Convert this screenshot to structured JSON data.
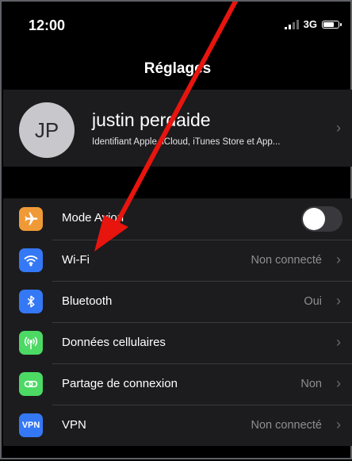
{
  "status_bar": {
    "time": "12:00",
    "network": "3G"
  },
  "nav": {
    "title": "Réglages"
  },
  "profile": {
    "initials": "JP",
    "name": "justin perdaide",
    "subtitle": "Identifiant Apple, iCloud, iTunes Store et App..."
  },
  "settings": [
    {
      "label": "Mode Avion",
      "value": "",
      "icon": "airplane-icon",
      "color": "#f09a37"
    },
    {
      "label": "Wi-Fi",
      "value": "Non connecté",
      "icon": "wifi-icon",
      "color": "#3478f6"
    },
    {
      "label": "Bluetooth",
      "value": "Oui",
      "icon": "bluetooth-icon",
      "color": "#3478f6"
    },
    {
      "label": "Données cellulaires",
      "value": "",
      "icon": "antenna-icon",
      "color": "#4cd964"
    },
    {
      "label": "Partage de connexion",
      "value": "Non",
      "icon": "hotspot-icon",
      "color": "#4cd964"
    },
    {
      "label": "VPN",
      "value": "Non connecté",
      "icon": "vpn-icon",
      "color": "#3478f6",
      "icon_text": "VPN"
    }
  ],
  "colors": {
    "annotation_arrow": "#e8140e"
  }
}
